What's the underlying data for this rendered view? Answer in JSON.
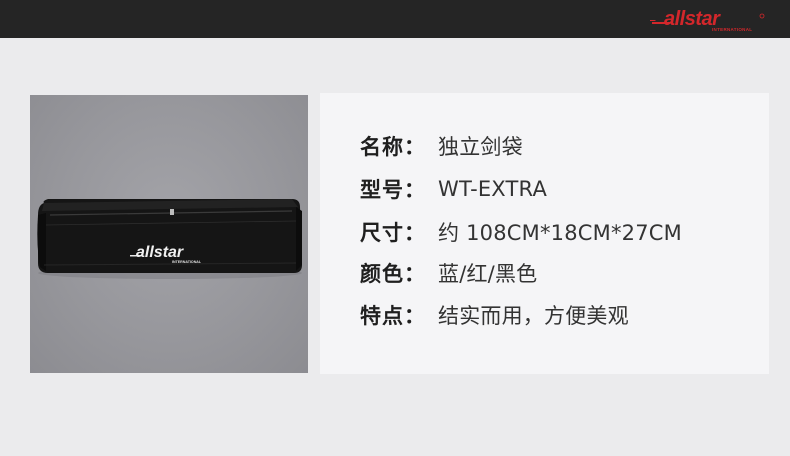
{
  "brand": {
    "logo_text": "allstar",
    "logo_subtext": "INTERNATIONAL",
    "logo_color": "#d3272b"
  },
  "product_image": {
    "bag_logo_text": "allstar",
    "bag_logo_subtext": "INTERNATIONAL",
    "bag_color": "#111111"
  },
  "specs": [
    {
      "label": "名称：",
      "value": "独立剑袋"
    },
    {
      "label": "型号：",
      "value": "WT-EXTRA"
    },
    {
      "label": "尺寸：",
      "value": "约 108CM*18CM*27CM"
    },
    {
      "label": "颜色：",
      "value": "蓝/红/黑色"
    },
    {
      "label": "特点：",
      "value": "结实而用，方便美观"
    }
  ],
  "colors": {
    "header_bg": "#252525",
    "page_bg": "#ebebed",
    "card_bg": "#f5f5f7"
  }
}
